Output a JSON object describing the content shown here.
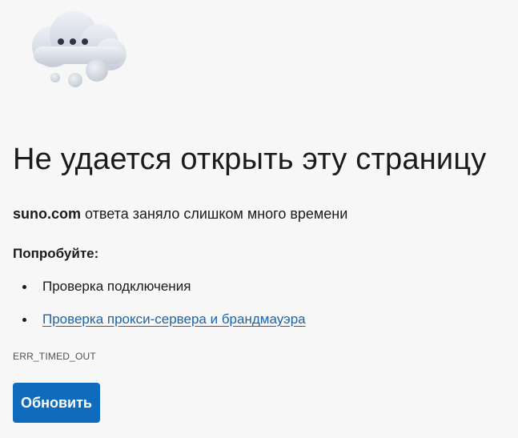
{
  "error": {
    "icon": "cloud-with-dots-icon",
    "headline": "Не удается открыть эту страницу",
    "host": "suno.com",
    "message": " ответа заняло слишком много времени",
    "try_label": "Попробуйте:",
    "suggestions": [
      {
        "label": "Проверка подключения",
        "is_link": false
      },
      {
        "label": "Проверка прокси-сервера и брандмауэра",
        "is_link": true
      }
    ],
    "code": "ERR_TIMED_OUT",
    "refresh_label": "Обновить"
  },
  "colors": {
    "background": "#f7f7f7",
    "text": "#1b1b1b",
    "link": "#1a64a8",
    "button": "#0f6cbd",
    "button_text": "#ffffff",
    "cloud": "#d5dae3"
  }
}
